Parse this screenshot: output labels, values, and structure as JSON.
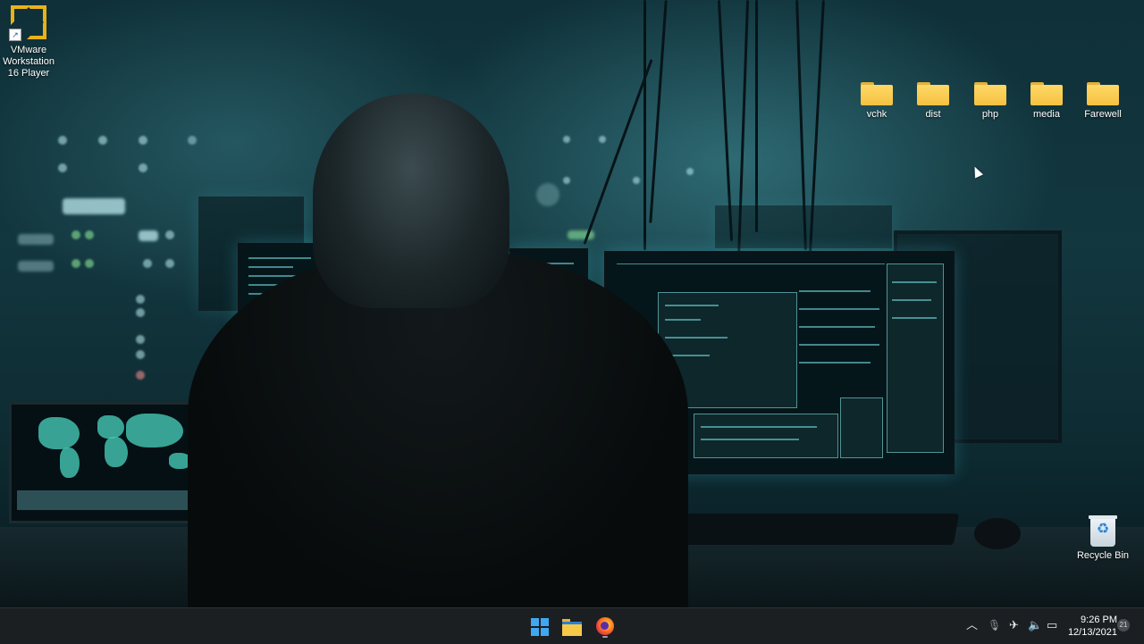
{
  "desktop": {
    "left_icons": [
      {
        "label": "VMware\nWorkstation\n16 Player",
        "icon": "vmware-icon",
        "shortcut": true
      }
    ],
    "top_right_folders": [
      {
        "label": "vchk",
        "icon": "folder-icon"
      },
      {
        "label": "dist",
        "icon": "folder-icon"
      },
      {
        "label": "php",
        "icon": "folder-icon"
      },
      {
        "label": "media",
        "icon": "folder-icon"
      },
      {
        "label": "Farewell",
        "icon": "folder-icon"
      }
    ],
    "recycle_bin": {
      "label": "Recycle Bin",
      "icon": "recycle-bin-icon"
    },
    "wallpaper": "hooded-hacker-at-monitors"
  },
  "taskbar": {
    "pinned": [
      {
        "name": "start",
        "icon": "windows-start-icon"
      },
      {
        "name": "file-explorer",
        "icon": "file-explorer-icon"
      },
      {
        "name": "firefox",
        "icon": "firefox-icon",
        "running": true
      }
    ],
    "tray": {
      "overflow_icon": "chevron-up-icon",
      "icons": [
        "microphone-icon",
        "network-icon",
        "volume-icon",
        "battery-icon"
      ]
    },
    "clock": {
      "time": "9:26 PM",
      "date": "12/13/2021"
    },
    "notifications_count": "21"
  },
  "colors": {
    "taskbar_bg": "#1c1f22",
    "folder_yellow": "#f5c242",
    "start_blue": "#3fa8f0"
  }
}
